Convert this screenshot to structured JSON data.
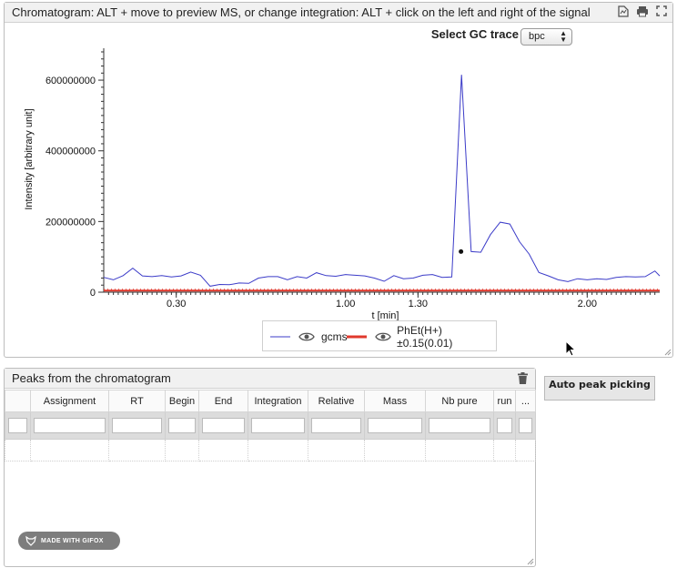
{
  "chromatogram": {
    "title": "Chromatogram: ALT + move to preview MS, or change integration: ALT + click on the left and right of the signal",
    "trace_label": "Select GC trace channel:",
    "trace_value": "bpc",
    "icons": [
      "export-icon",
      "print-icon",
      "fullscreen-icon"
    ]
  },
  "chart_data": {
    "type": "line",
    "xlabel": "t [min]",
    "ylabel": "Intensity [arbitrary unit]",
    "xlim": [
      0.0,
      2.3
    ],
    "ylim": [
      0,
      680000000
    ],
    "x_ticks": [
      0.3,
      1.0,
      1.3,
      2.0
    ],
    "x_tick_labels": [
      "0.30",
      "1.00",
      "1.30",
      "2.00"
    ],
    "y_ticks": [
      0,
      200000000,
      400000000,
      600000000
    ],
    "y_tick_labels": [
      "0",
      "200000000",
      "400000000",
      "600000000"
    ],
    "series": [
      {
        "name": "gcms",
        "color": "#3b3bc8",
        "x": [
          0.0,
          0.04,
          0.08,
          0.12,
          0.16,
          0.2,
          0.24,
          0.28,
          0.32,
          0.36,
          0.4,
          0.44,
          0.48,
          0.52,
          0.56,
          0.6,
          0.64,
          0.68,
          0.72,
          0.76,
          0.8,
          0.84,
          0.88,
          0.92,
          0.96,
          1.0,
          1.04,
          1.08,
          1.12,
          1.16,
          1.2,
          1.24,
          1.28,
          1.32,
          1.36,
          1.4,
          1.44,
          1.48,
          1.52,
          1.56,
          1.6,
          1.64,
          1.68,
          1.72,
          1.76,
          1.8,
          1.84,
          1.88,
          1.92,
          1.96,
          2.0,
          2.04,
          2.08,
          2.12,
          2.16,
          2.2,
          2.24,
          2.28,
          2.3
        ],
        "values": [
          42000000,
          35000000,
          47000000,
          68000000,
          46000000,
          44000000,
          47000000,
          43000000,
          46000000,
          57000000,
          48000000,
          17000000,
          22000000,
          21000000,
          26000000,
          25000000,
          40000000,
          44000000,
          44000000,
          35000000,
          44000000,
          40000000,
          55000000,
          47000000,
          45000000,
          50000000,
          48000000,
          46000000,
          40000000,
          31000000,
          47000000,
          38000000,
          40000000,
          48000000,
          50000000,
          42000000,
          43000000,
          615000000,
          115000000,
          113000000,
          163000000,
          198000000,
          193000000,
          143000000,
          108000000,
          56000000,
          46000000,
          35000000,
          30000000,
          38000000,
          35000000,
          38000000,
          36000000,
          42000000,
          44000000,
          43000000,
          44000000,
          60000000,
          46000000
        ]
      },
      {
        "name": "PhEt(H+)±0.15(0.01)",
        "color": "#e0382c",
        "x": [
          0.0,
          2.3
        ],
        "values": [
          2000000,
          2000000
        ]
      }
    ],
    "marker": {
      "x": 1.478,
      "y": 115000000
    },
    "legend_position": "bottom"
  },
  "peaks": {
    "title": "Peaks from the chromatogram",
    "columns": [
      "",
      "Assignment",
      "RT",
      "Begin",
      "End",
      "Integration",
      "Relative",
      "Mass",
      "Nb pure",
      "run",
      "..."
    ],
    "auto_button": "Auto peak picking"
  },
  "watermark": {
    "label": "MADE WITH GIFOX"
  }
}
